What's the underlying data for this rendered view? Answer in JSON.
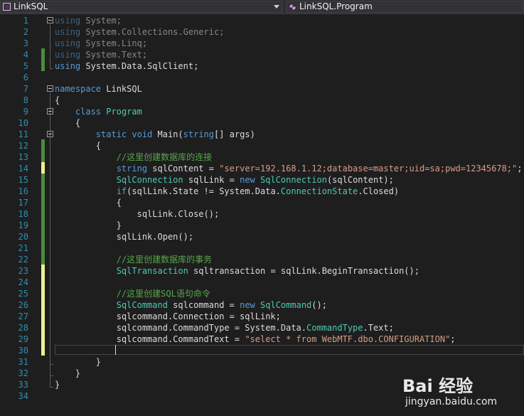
{
  "toolbar": {
    "project_dropdown": "LinkSQL",
    "member_dropdown": "LinkSQL.Program"
  },
  "colors": {
    "keyword": "#569cd6",
    "type": "#4ec9b0",
    "string": "#d69d85",
    "comment": "#57a64a",
    "line_number": "#2b91af",
    "saved_change": "#4b8b3b",
    "unsaved_change": "#efef91"
  },
  "lines": [
    {
      "n": "1",
      "t": [
        [
          "kw dim",
          "using"
        ],
        [
          "dim",
          " System;"
        ]
      ]
    },
    {
      "n": "2",
      "t": [
        [
          "kw dim",
          "using"
        ],
        [
          "dim",
          " System.Collections.Generic;"
        ]
      ]
    },
    {
      "n": "3",
      "t": [
        [
          "kw dim",
          "using"
        ],
        [
          "dim",
          " System.Linq;"
        ]
      ]
    },
    {
      "n": "4",
      "t": [
        [
          "kw dim",
          "using"
        ],
        [
          "dim",
          " System.Text;"
        ]
      ]
    },
    {
      "n": "5",
      "t": [
        [
          "kw",
          "using"
        ],
        [
          "ns",
          " System.Data.SqlClient;"
        ]
      ]
    },
    {
      "n": "6",
      "t": []
    },
    {
      "n": "7",
      "t": [
        [
          "kw",
          "namespace"
        ],
        [
          "ns",
          " LinkSQL"
        ]
      ]
    },
    {
      "n": "8",
      "t": [
        [
          "ns",
          "{"
        ]
      ]
    },
    {
      "n": "9",
      "t": [
        [
          "ns",
          "    "
        ],
        [
          "kw",
          "class"
        ],
        [
          "ns",
          " "
        ],
        [
          "ty",
          "Program"
        ]
      ]
    },
    {
      "n": "10",
      "t": [
        [
          "ns",
          "    {"
        ]
      ]
    },
    {
      "n": "11",
      "t": [
        [
          "ns",
          "        "
        ],
        [
          "kw",
          "static"
        ],
        [
          "ns",
          " "
        ],
        [
          "kw",
          "void"
        ],
        [
          "ns",
          " Main("
        ],
        [
          "kw",
          "string"
        ],
        [
          "ns",
          "[] args)"
        ]
      ]
    },
    {
      "n": "12",
      "t": [
        [
          "ns",
          "        {"
        ]
      ]
    },
    {
      "n": "13",
      "t": [
        [
          "ns",
          "            "
        ],
        [
          "cm",
          "//这里创建数据库的连接"
        ]
      ]
    },
    {
      "n": "14",
      "t": [
        [
          "ns",
          "            "
        ],
        [
          "kw",
          "string"
        ],
        [
          "ns",
          " sqlContent = "
        ],
        [
          "st",
          "\"server=192.168.1.12;database=master;uid=sa;pwd=12345678;\""
        ],
        [
          "ns",
          ";"
        ]
      ]
    },
    {
      "n": "15",
      "t": [
        [
          "ns",
          "            "
        ],
        [
          "ty",
          "SqlConnection"
        ],
        [
          "ns",
          " sqlLink = "
        ],
        [
          "kw",
          "new"
        ],
        [
          "ns",
          " "
        ],
        [
          "ty",
          "SqlConnection"
        ],
        [
          "ns",
          "(sqlContent);"
        ]
      ]
    },
    {
      "n": "16",
      "t": [
        [
          "ns",
          "            "
        ],
        [
          "kw",
          "if"
        ],
        [
          "ns",
          "(sqlLink.State != System.Data."
        ],
        [
          "ty",
          "ConnectionState"
        ],
        [
          "ns",
          ".Closed)"
        ]
      ]
    },
    {
      "n": "17",
      "t": [
        [
          "ns",
          "            {"
        ]
      ]
    },
    {
      "n": "18",
      "t": [
        [
          "ns",
          "                sqlLink.Close();"
        ]
      ]
    },
    {
      "n": "19",
      "t": [
        [
          "ns",
          "            }"
        ]
      ]
    },
    {
      "n": "20",
      "t": [
        [
          "ns",
          "            sqlLink.Open();"
        ]
      ]
    },
    {
      "n": "21",
      "t": []
    },
    {
      "n": "22",
      "t": [
        [
          "ns",
          "            "
        ],
        [
          "cm",
          "//这里创建数据库的事务"
        ]
      ]
    },
    {
      "n": "23",
      "t": [
        [
          "ns",
          "            "
        ],
        [
          "ty",
          "SqlTransaction"
        ],
        [
          "ns",
          " sqltransaction = sqlLink.BeginTransaction();"
        ]
      ]
    },
    {
      "n": "24",
      "t": []
    },
    {
      "n": "25",
      "t": [
        [
          "ns",
          "            "
        ],
        [
          "cm",
          "//这里创建SQL语句命令"
        ]
      ]
    },
    {
      "n": "26",
      "t": [
        [
          "ns",
          "            "
        ],
        [
          "ty",
          "SqlCommand"
        ],
        [
          "ns",
          " sqlcommand = "
        ],
        [
          "kw",
          "new"
        ],
        [
          "ns",
          " "
        ],
        [
          "ty",
          "SqlCommand"
        ],
        [
          "ns",
          "();"
        ]
      ]
    },
    {
      "n": "27",
      "t": [
        [
          "ns",
          "            sqlcommand.Connection = sqlLink;"
        ]
      ]
    },
    {
      "n": "28",
      "t": [
        [
          "ns",
          "            sqlcommand.CommandType = System.Data."
        ],
        [
          "ty",
          "CommandType"
        ],
        [
          "ns",
          ".Text;"
        ]
      ]
    },
    {
      "n": "29",
      "t": [
        [
          "ns",
          "            sqlcommand.CommandText = "
        ],
        [
          "st",
          "\"select * from WebMTF.dbo.CONFIGURATION\""
        ],
        [
          "ns",
          ";"
        ]
      ]
    },
    {
      "n": "30",
      "t": []
    },
    {
      "n": "31",
      "t": [
        [
          "ns",
          "        }"
        ]
      ]
    },
    {
      "n": "32",
      "t": [
        [
          "ns",
          "    }"
        ]
      ]
    },
    {
      "n": "33",
      "t": [
        [
          "ns",
          "}"
        ]
      ]
    },
    {
      "n": "34",
      "t": []
    }
  ],
  "watermark": {
    "top": "Bai 经验",
    "bottom": "jingyan.baidu.com"
  }
}
